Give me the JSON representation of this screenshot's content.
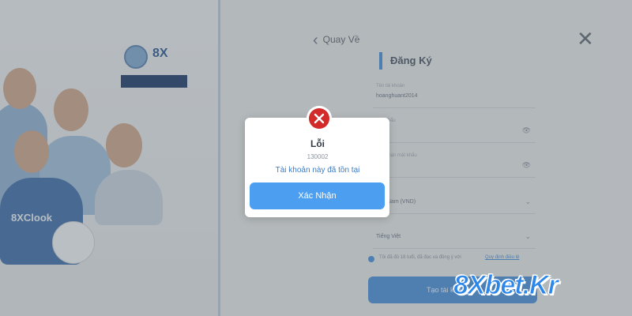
{
  "background_page": {
    "back_label": "Quay Về",
    "form_title": "Đăng Ký",
    "fields": [
      {
        "label": "Tên tài khoản",
        "value": "hoanghuant2014",
        "chevron": ""
      },
      {
        "label": "Mật khẩu",
        "value": "••••••",
        "chevron": "👁"
      },
      {
        "label": "Xác nhận mật khẩu",
        "value": "••••••",
        "chevron": "👁"
      },
      {
        "label": "",
        "value": "Việt Nam (VND)",
        "chevron": "⌄"
      },
      {
        "label": "",
        "value": "Tiếng Việt",
        "chevron": "⌄"
      }
    ],
    "agree_text": "Tôi đã đủ 18 tuổi, đã đọc và đồng ý với",
    "agree_link": "Quy định điều lệ",
    "create_button": "Tạo tài khoản",
    "shirt_brand": "8XClook"
  },
  "error_dialog": {
    "title": "Lỗi",
    "code": "130002",
    "message": "Tài khoản này đã tồn tại",
    "confirm_label": "Xác Nhận",
    "icon": "error-x-icon"
  },
  "watermark": {
    "text": "8Xbet.Kr"
  },
  "colors": {
    "accent": "#4c9ff0",
    "error": "#d32a2a",
    "watermark": "#2d86ea"
  }
}
